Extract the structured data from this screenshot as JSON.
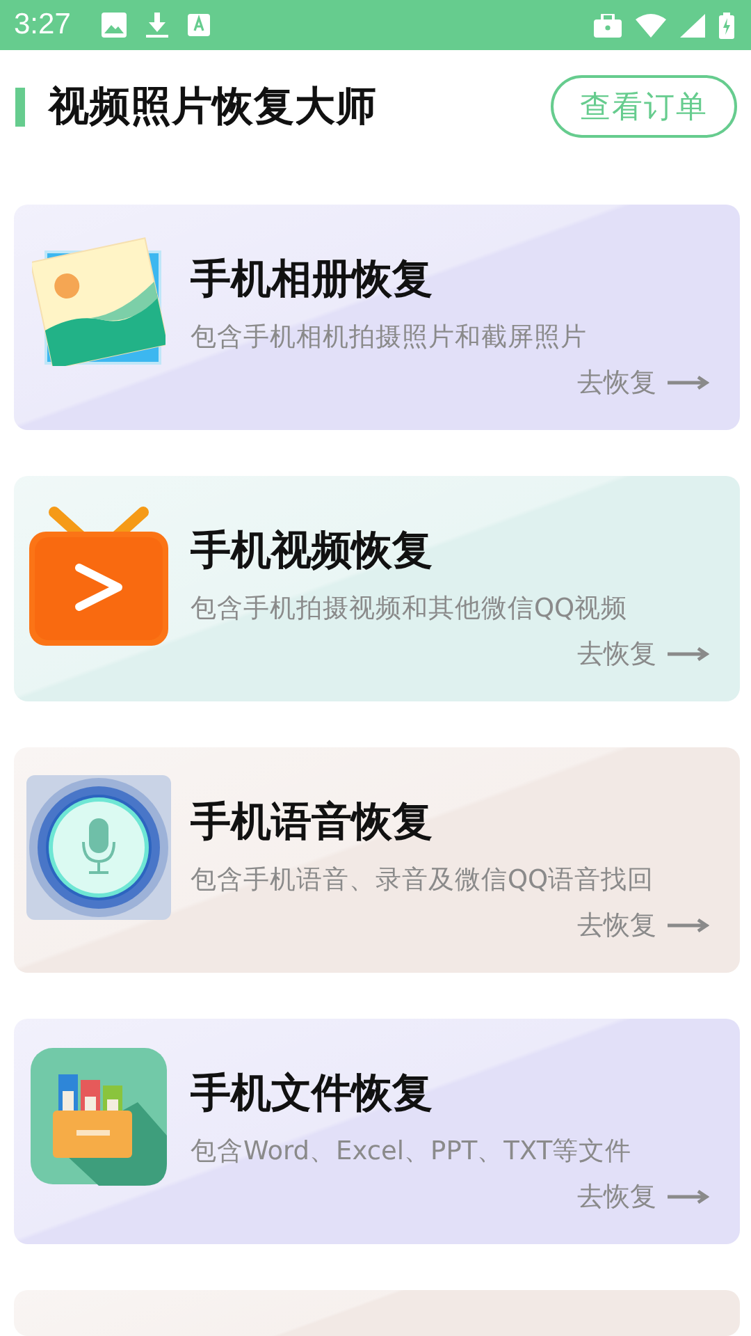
{
  "status_bar": {
    "time": "3:27"
  },
  "header": {
    "title": "视频照片恢复大师",
    "orders_button": "查看订单"
  },
  "cards": [
    {
      "kind": "photo",
      "color": "#e2e0f8",
      "title": "手机相册恢复",
      "description": "包含手机相机拍摄照片和截屏照片",
      "action": "去恢复"
    },
    {
      "kind": "video",
      "color": "#dff1ef",
      "title": "手机视频恢复",
      "description": "包含手机拍摄视频和其他微信QQ视频",
      "action": "去恢复"
    },
    {
      "kind": "voice",
      "color": "#f2e9e5",
      "title": "手机语音恢复",
      "description": "包含手机语音、录音及微信QQ语音找回",
      "action": "去恢复"
    },
    {
      "kind": "file",
      "color": "#e2e0f8",
      "title": "手机文件恢复",
      "description": "包含Word、Excel、PPT、TXT等文件",
      "action": "去恢复"
    },
    {
      "kind": "partial",
      "color": "#f2e9e5"
    }
  ]
}
